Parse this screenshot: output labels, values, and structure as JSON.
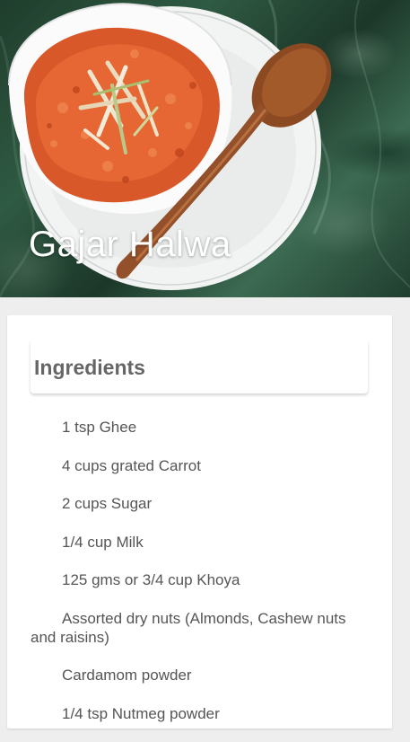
{
  "recipe": {
    "title": "Gajar Halwa"
  },
  "ingredients_section": {
    "heading": "Ingredients",
    "items": [
      "1 tsp Ghee",
      "4 cups grated Carrot",
      "2 cups Sugar",
      "1/4 cup Milk",
      "125 gms or 3/4 cup Khoya",
      "Assorted dry nuts (Almonds, Cashew nuts and raisins)",
      "Cardamom powder",
      "1/4 tsp Nutmeg powder"
    ]
  }
}
